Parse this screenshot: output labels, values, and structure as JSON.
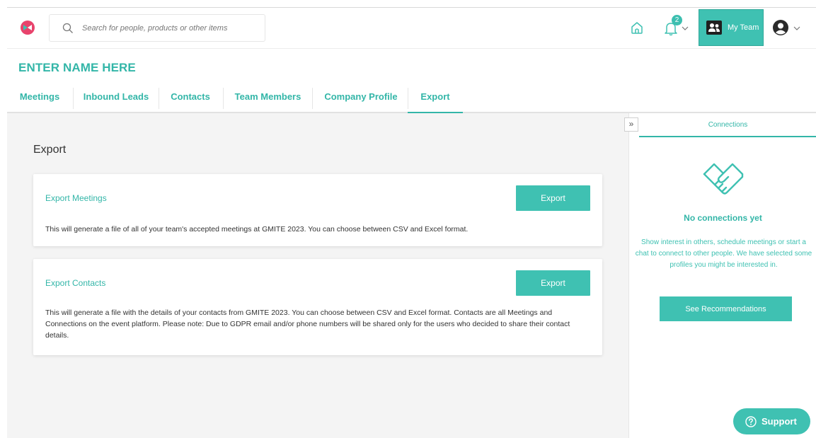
{
  "header": {
    "search_placeholder": "Search for people, products or other items",
    "notifications_count": "2",
    "my_team_label": "My Team"
  },
  "page": {
    "title": "ENTER NAME HERE"
  },
  "tabs": [
    {
      "label": "Meetings"
    },
    {
      "label": "Inbound Leads"
    },
    {
      "label": "Contacts"
    },
    {
      "label": "Team Members"
    },
    {
      "label": "Company Profile"
    },
    {
      "label": "Export"
    }
  ],
  "main": {
    "section_title": "Export",
    "cards": [
      {
        "title": "Export Meetings",
        "button_label": "Export",
        "description": "This will generate a file of all of your team's accepted meetings at GMITE 2023. You can choose between CSV and Excel format."
      },
      {
        "title": "Export Contacts",
        "button_label": "Export",
        "description": "This will generate a file with the details of your contacts from GMITE 2023. You can choose between CSV and Excel format. Contacts are all Meetings and Connections on the event platform. Please note: Due to GDPR email and/or phone numbers will be shared only for the users who decided to share their contact details."
      }
    ]
  },
  "right_panel": {
    "tab_label": "Connections",
    "empty_title": "No connections yet",
    "empty_description": "Show interest in others, schedule meetings or start a chat to connect to other people. We have selected some profiles you might be interested in.",
    "button_label": "See Recommendations",
    "collapse_glyph": "»"
  },
  "support": {
    "label": "Support"
  },
  "colors": {
    "accent": "#3fc1b2",
    "accent_text": "#33b6a8",
    "logo_pink": "#e8436c",
    "main_bg": "#f4f4f4"
  },
  "icons": {
    "logo": "brand-logo-icon",
    "search": "search-icon",
    "home": "home-icon",
    "bell": "bell-icon",
    "team": "team-icon",
    "avatar": "user-avatar-icon",
    "chevron": "chevron-down-icon",
    "handshake": "handshake-icon",
    "help": "question-circle-icon"
  }
}
